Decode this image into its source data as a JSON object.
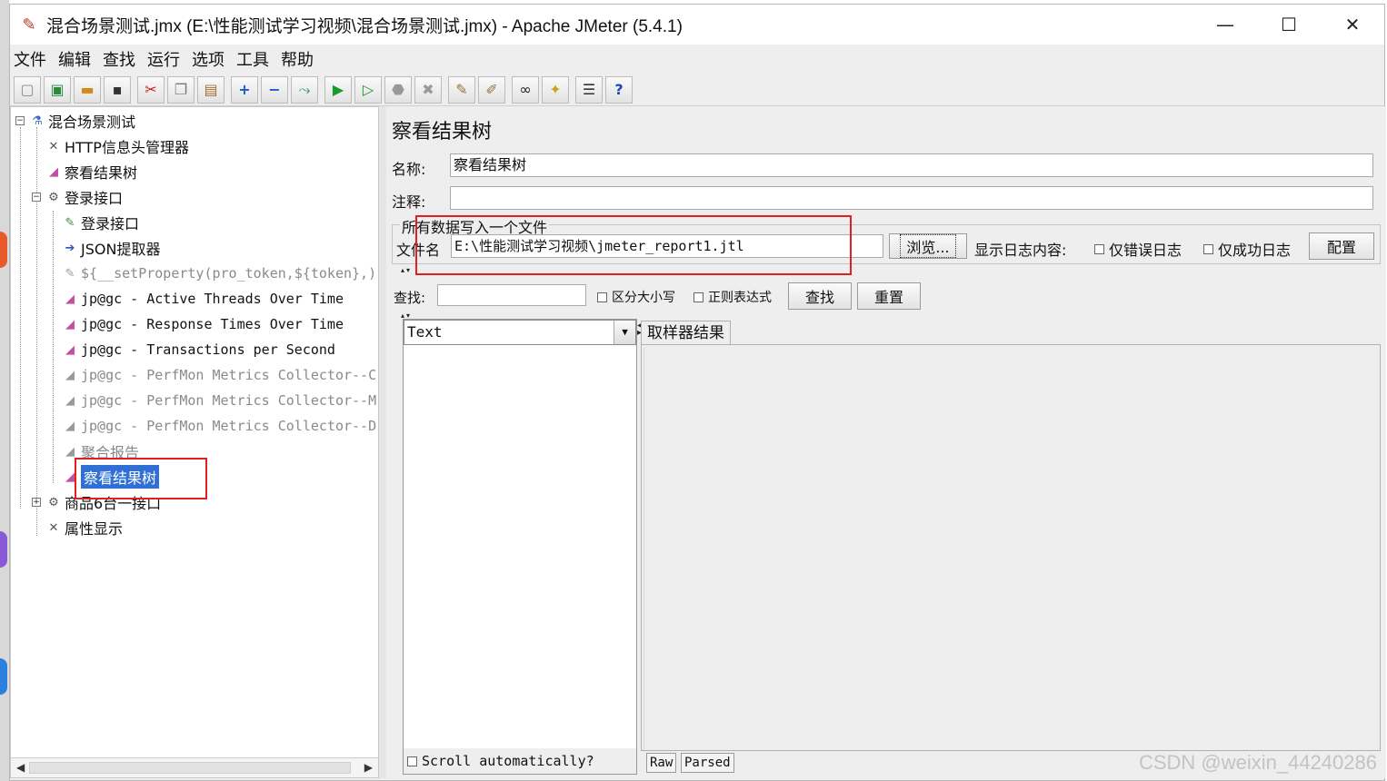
{
  "window": {
    "title": "混合场景测试.jmx (E:\\性能测试学习视频\\混合场景测试.jmx) - Apache JMeter (5.4.1)",
    "minimize": "—",
    "maximize": "☐",
    "close": "✕"
  },
  "menu": [
    "文件",
    "编辑",
    "查找",
    "运行",
    "选项",
    "工具",
    "帮助"
  ],
  "toolbar": {
    "icons": [
      "new-icon",
      "templates-icon",
      "open-icon",
      "save-icon",
      "cut-icon",
      "copy-icon",
      "paste-icon",
      "expand-icon",
      "collapse-icon",
      "toggle-icon",
      "start-icon",
      "start-no-pause-icon",
      "stop-icon",
      "shutdown-icon",
      "clear-icon",
      "clear-all-icon",
      "search-icon",
      "reset-search-icon",
      "function-helper-icon",
      "help-icon"
    ]
  },
  "tree": {
    "items": [
      {
        "label": "混合场景测试",
        "icon": "test-plan-icon",
        "disabled": false
      },
      {
        "label": "HTTP信息头管理器",
        "icon": "config-icon",
        "disabled": false
      },
      {
        "label": "察看结果树",
        "icon": "listener-icon",
        "disabled": false
      },
      {
        "label": "登录接口",
        "icon": "thread-group-icon",
        "disabled": false
      },
      {
        "label": "登录接口",
        "icon": "sampler-icon",
        "disabled": false
      },
      {
        "label": "JSON提取器",
        "icon": "extractor-icon",
        "disabled": false
      },
      {
        "label": "${__setProperty(pro_token,${token},)",
        "icon": "sampler-icon",
        "disabled": true
      },
      {
        "label": "jp@gc - Active Threads Over Time",
        "icon": "listener-icon",
        "disabled": false
      },
      {
        "label": "jp@gc - Response Times Over Time",
        "icon": "listener-icon",
        "disabled": false
      },
      {
        "label": "jp@gc - Transactions per Second",
        "icon": "listener-icon",
        "disabled": false
      },
      {
        "label": "jp@gc - PerfMon Metrics Collector--C",
        "icon": "listener-icon",
        "disabled": true
      },
      {
        "label": "jp@gc - PerfMon Metrics Collector--M",
        "icon": "listener-icon",
        "disabled": true
      },
      {
        "label": "jp@gc - PerfMon Metrics Collector--D",
        "icon": "listener-icon",
        "disabled": true
      },
      {
        "label": "聚合报告",
        "icon": "listener-icon",
        "disabled": true
      },
      {
        "label": "察看结果树",
        "icon": "listener-icon",
        "disabled": false
      },
      {
        "label": "商品6台一接口",
        "icon": "thread-group-icon",
        "disabled": false
      },
      {
        "label": "属性显示",
        "icon": "config-icon",
        "disabled": false
      }
    ],
    "selected": 14
  },
  "panel": {
    "title": "察看结果树",
    "name_label": "名称:",
    "name_value": "察看结果树",
    "comment_label": "注释:",
    "comment_value": "",
    "file_group_title": "所有数据写入一个文件",
    "filename_label": "文件名",
    "filename_value": "E:\\性能测试学习视频\\jmeter_report1.jtl",
    "browse_button": "浏览...",
    "log_content_label": "显示日志内容:",
    "errors_only": "仅错误日志",
    "success_only": "仅成功日志",
    "configure_button": "配置",
    "search_label": "查找:",
    "search_value": "",
    "case_sensitive": "区分大小写",
    "regex": "正则表达式",
    "find_button": "查找",
    "reset_button": "重置",
    "renderer_selected": "Text",
    "scroll_auto": "Scroll automatically?",
    "result_tab": "取样器结果",
    "raw_tab": "Raw",
    "parsed_tab": "Parsed"
  },
  "watermark": "CSDN @weixin_44240286",
  "colors": {
    "selection": "#2f6fd6",
    "highlight_box": "#e02020",
    "start_green": "#1a9a2a"
  }
}
